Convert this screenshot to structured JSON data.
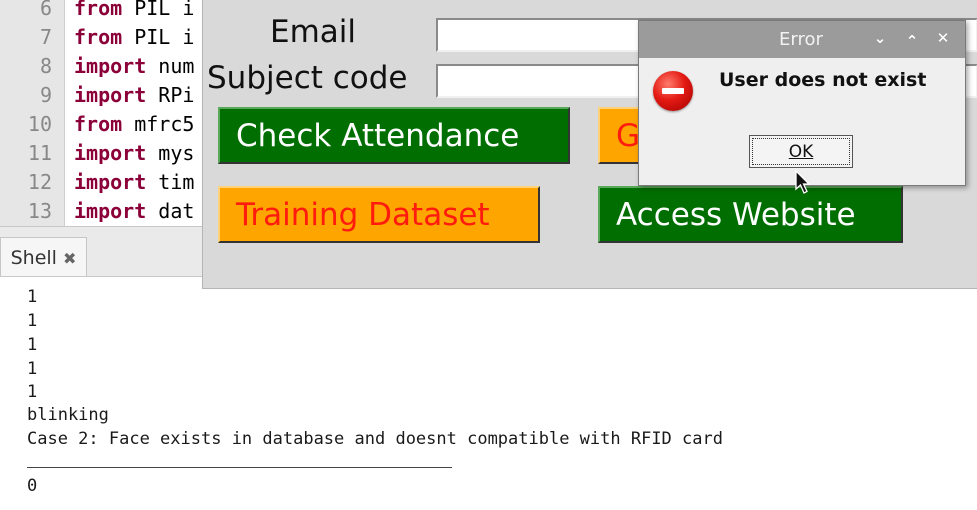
{
  "editor": {
    "lines": [
      {
        "num": "6",
        "kw": "from",
        "rest": " PIL i"
      },
      {
        "num": "7",
        "kw": "from",
        "rest": " PIL i"
      },
      {
        "num": "8",
        "kw": "import",
        "rest": " num"
      },
      {
        "num": "9",
        "kw": "import",
        "rest": " RPi"
      },
      {
        "num": "10",
        "kw": "from",
        "rest": " mfrc5"
      },
      {
        "num": "11",
        "kw": "import",
        "rest": " mys"
      },
      {
        "num": "12",
        "kw": "import",
        "rest": " tim"
      },
      {
        "num": "13",
        "kw": "import",
        "rest": " dat"
      }
    ]
  },
  "shell": {
    "tab_label": "Shell",
    "output": [
      "1",
      "1",
      "1",
      "1",
      "1",
      "blinking",
      "Case 2: Face exists in database and doesnt compatible with RFID card",
      "0"
    ]
  },
  "app": {
    "email_label": "Email",
    "email_value": "",
    "subject_label": "Subject code",
    "subject_value": "",
    "check_attendance": "Check Attendance",
    "hidden_button_partial": "G",
    "training_dataset": "Training Dataset",
    "access_website": "Access Website"
  },
  "dialog": {
    "title": "Error",
    "message": "User does not exist",
    "ok_label": "OK",
    "controls": [
      "chevron-down-icon",
      "chevron-up-icon",
      "close-icon"
    ]
  },
  "colors": {
    "button_green": "#016e02",
    "button_orange": "#ffa500",
    "orange_text": "#ff1b0e",
    "keyword": "#8b0039"
  }
}
